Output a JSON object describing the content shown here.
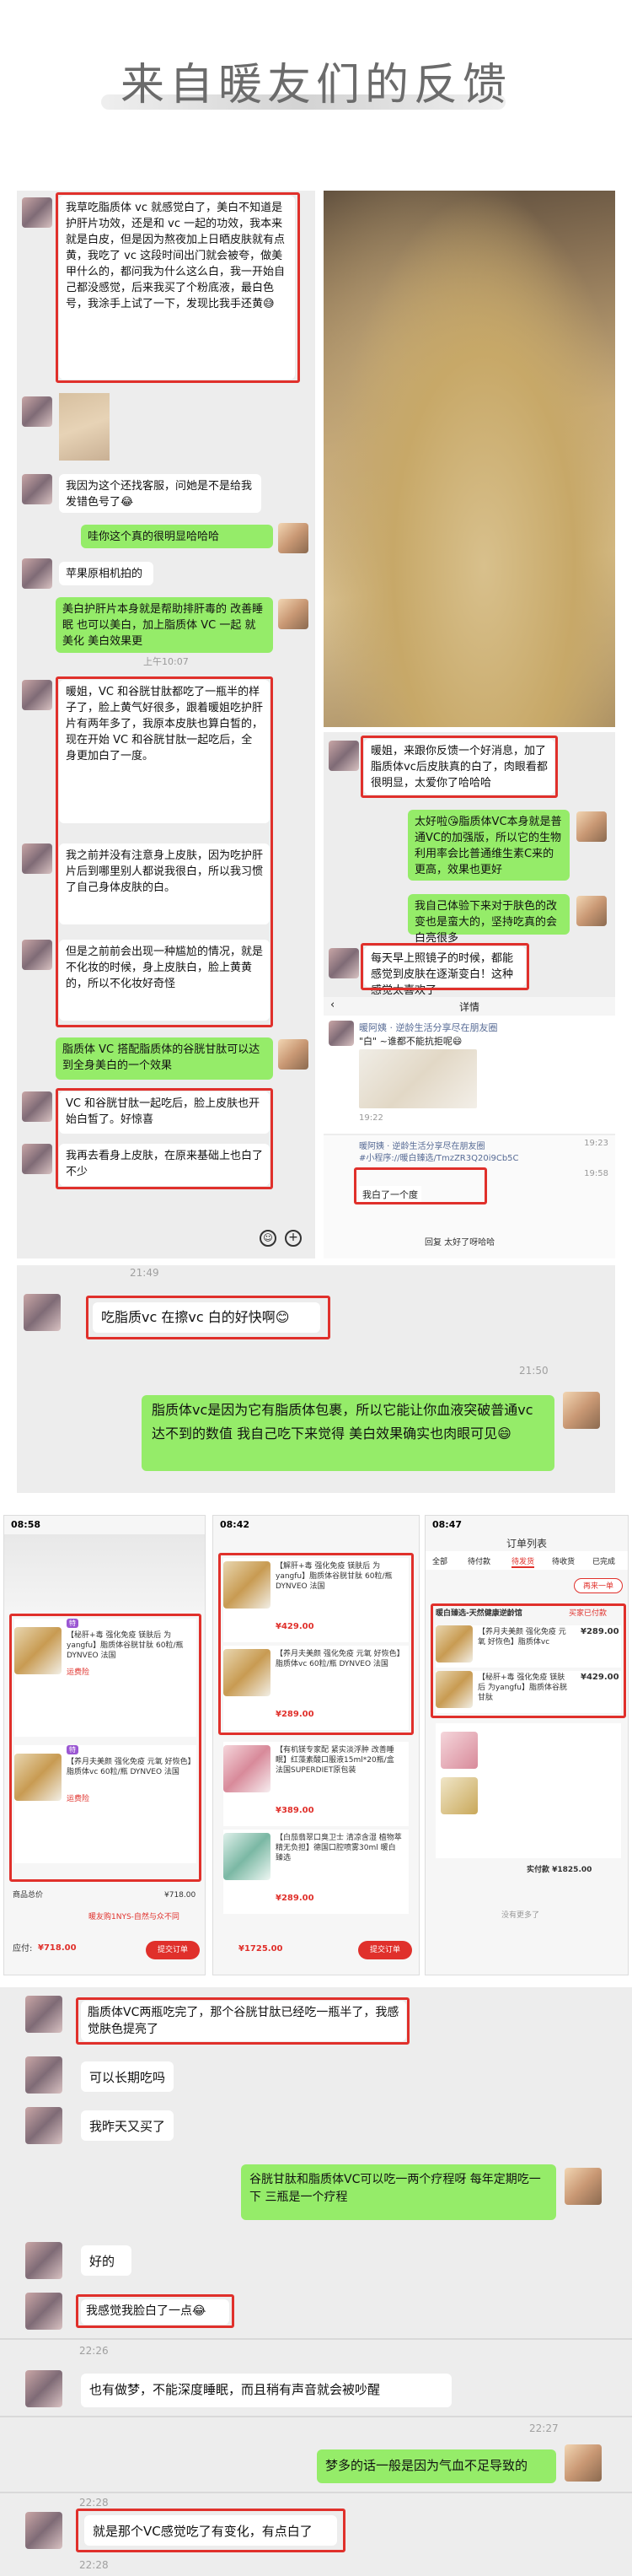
{
  "title": "来自暖友们的反馈",
  "panel_a": {
    "msg1": "我草吃脂质体 vc 就感觉白了，美白不知道是护肝片功效，还是和 vc 一起的功效，我本来就是白皮，但是因为熬夜加上日晒皮肤就有点黄，我吃了 vc 这段时间出门就会被夸，做美甲什么的，都问我为什么这么白，我一开始自己都没感觉，后来我买了个粉底液，最白色号，我涂手上试了一下，发现比我手还黄😅",
    "msg2": "我因为这个还找客服，问她是不是给我发错色号了😂",
    "msg3": "哇你这个真的很明显哈哈哈",
    "msg4": "苹果原相机拍的",
    "msg5": "美白护肝片本身就是帮助排肝毒的 改善睡眠 也可以美白，加上脂质体 VC 一起 就美化 美白效果更",
    "time1": "上午10:07",
    "msg6": "暖姐，VC 和谷胱甘肽都吃了一瓶半的样子了，脸上黄气好很多，跟着暖姐吃护肝片有两年多了，我原本皮肤也算白皙的，现在开始 VC 和谷胱甘肽一起吃后，全身更加白了一度。",
    "msg7": "我之前并没有注意身上皮肤，因为吃护肝片后到哪里别人都说我很白，所以我习惯了自己身体皮肤的白。",
    "msg8": "但是之前前会出现一种尴尬的情况，就是不化妆的时候，身上皮肤白，脸上黄黄的，所以不化妆好奇怪",
    "msg9": "脂质体 VC 搭配脂质体的谷胱甘肽可以达到全身美白的一个效果",
    "msg10": "VC 和谷胱甘肽一起吃后，脸上皮肤也开始白皙了。好惊喜",
    "msg11": "我再去看身上皮肤，在原来基础上也白了不少"
  },
  "panel_b": {
    "msg1": "暖姐，来跟你反馈一个好消息，加了脂质体vc后皮肤真的白了，肉眼看都很明显，太爱你了哈哈哈",
    "msg2": "太好啦😘脂质体VC本身就是普通VC的加强版，所以它的生物利用率会比普通维生素C来的更高，效果也更好",
    "msg3": "我自己体验下来对于肤色的改变也是蛮大的，坚持吃真的会白亮很多",
    "msg4": "每天早上照镜子的时候，都能感觉到皮肤在逐渐变白！这种感觉太喜欢了",
    "detail_label": "详情",
    "moment_name": "暖阿姨 · 逆龄生活分享尽在朋友圈",
    "moment_text": "\"白\" ~谁都不能抗拒呢😄",
    "moment_time": "19:22",
    "share_name": "暖阿姨 · 逆龄生活分享尽在朋友圈",
    "share_link": "#小程序://暖白臻选/TmzZR3Q20i9Cb5C",
    "share_time": "19:23",
    "reply_quote": "我白了一个度",
    "reply_time": "19:58",
    "last_line": "回复 太好了呀哈哈"
  },
  "panel_c": {
    "time": "21:49",
    "msg1": "吃脂质vc 在擦vc 白的好快啊😊",
    "time2": "21:50",
    "msg2": "脂质体vc是因为它有脂质体包裹，所以它能让你血液突破普通vc达不到的数值 我自己吃下来觉得 美白效果确实也肉眼可见😄"
  },
  "phones": {
    "p1": {
      "status": "08:58",
      "item1": "【秘肝+毒 强化免疫 镁肤后 为yangfu】脂质体谷胱甘肽 60粒/瓶 DYNVEO 法国",
      "item2": "【养月夫美颜 强化免疫 元氧 好恢色】脂质体vc 60粒/瓶 DYNVEO 法国",
      "badge": "运费险",
      "total_label": "商品总价",
      "total": "¥718.00",
      "pay_label": "应付:",
      "pay": "¥718.00",
      "submit": "提交订单",
      "ship": "暖友购1NYS-自然与众不同"
    },
    "p2": {
      "status": "08:42",
      "item1": "【解肝+毒 强化免疫 镁肤后 为yangfu】脂质体谷胱甘肽 60粒/瓶 DYNVEO 法国",
      "price1": "¥429.00",
      "item2": "【养月夫美颜 强化免疫 元氧 好恢色】脂质体vc 60粒/瓶 DYNVEO 法国",
      "price2": "¥289.00",
      "item3": "【有机镁专家配 紧实淡浮肿 改善睡眠】红藻素酸口服液15ml*20瓶/盒 法国SUPERDIET原包装",
      "price3": "¥389.00",
      "item4": "【白茄翡翠口臭卫士 清凉含湿 植物萃精无负担】德国口腔喷雾30ml 暖白臻选",
      "price4": "¥289.00",
      "pay": "¥1725.00",
      "submit": "提交订单"
    },
    "p3": {
      "status": "08:47",
      "title": "订单列表",
      "tab1": "全部",
      "tab2": "待付款",
      "tab3": "待发货",
      "tab4": "待收货",
      "tab5": "已完成",
      "store": "暖白臻选-天然健康逆龄馆",
      "status_text": "买家已付款",
      "item1": "【养月夫美颜 强化免疫 元氧 好恢色】脂质体vc",
      "price1": "¥289.00",
      "item2": "【秘肝+毒 强化免疫 镁肤后 为yangfu】脂质体谷胱甘肽",
      "price2": "¥429.00",
      "total": "实付款 ¥1825.00",
      "again": "再来一单",
      "more": "没有更多了"
    }
  },
  "chat2": {
    "m1": "脂质体VC两瓶吃完了，那个谷胱甘肽已经吃一瓶半了，我感觉肤色提亮了",
    "m2": "可以长期吃吗",
    "m3": "我昨天又买了",
    "m4": "谷胱甘肽和脂质体VC可以吃一两个疗程呀 每年定期吃一下 三瓶是一个疗程",
    "m5": "好的",
    "m6": "我感觉我脸白了一点😂",
    "t1": "22:26",
    "m7": "也有做梦，不能深度睡眠，而且稍有声音就会被吵醒",
    "t2": "22:27",
    "m8": "梦多的话一般是因为气血不足导致的",
    "t3": "22:28",
    "m9": "就是那个VC感觉吃了有变化，有点白了",
    "t4": "22:28"
  }
}
